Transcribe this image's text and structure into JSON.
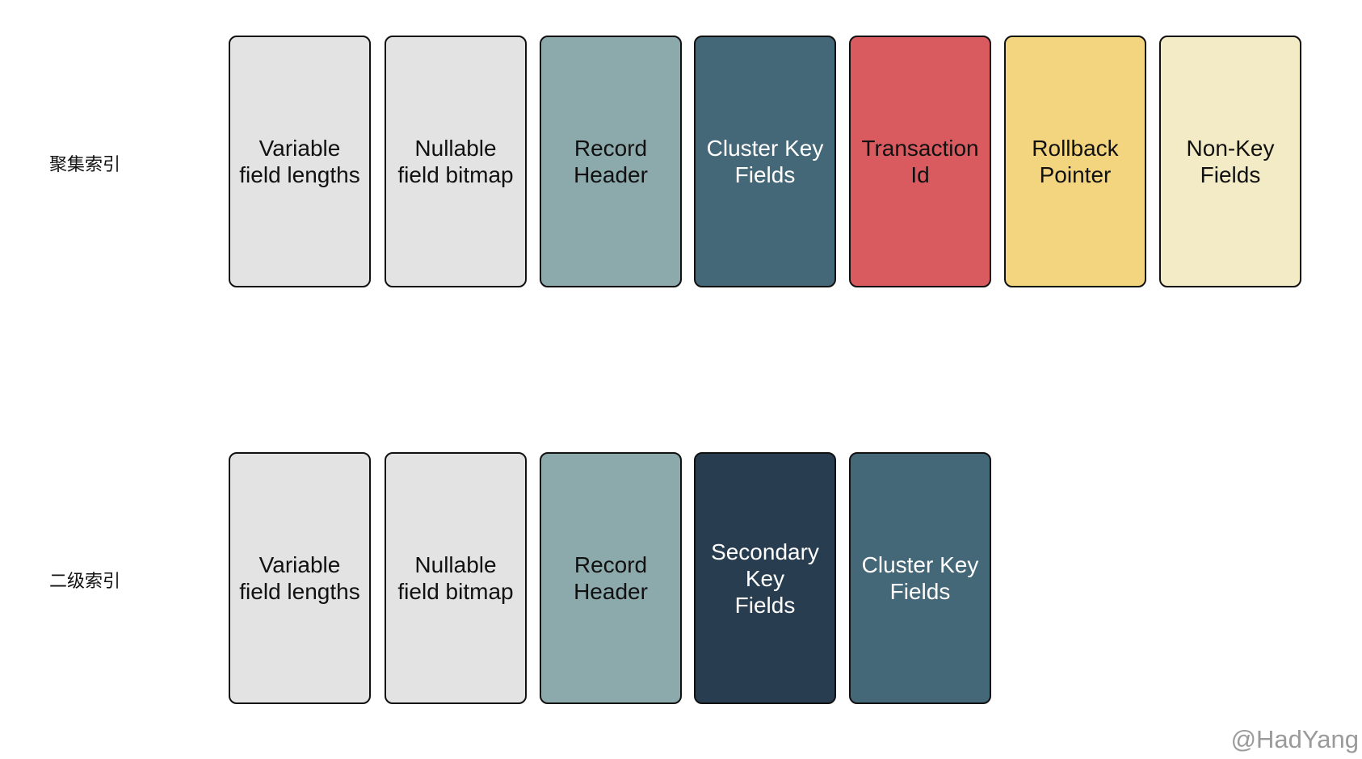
{
  "rows": [
    {
      "label": "聚集索引",
      "cells": [
        {
          "text": "Variable\nfield lengths",
          "bg": "#e3e3e3",
          "fg": "#111111"
        },
        {
          "text": "Nullable\nfield bitmap",
          "bg": "#e3e3e3",
          "fg": "#111111"
        },
        {
          "text": "Record\nHeader",
          "bg": "#8ca9ac",
          "fg": "#111111"
        },
        {
          "text": "Cluster Key\nFields",
          "bg": "#456878",
          "fg": "#ffffff"
        },
        {
          "text": "Transaction\nId",
          "bg": "#d95b60",
          "fg": "#111111"
        },
        {
          "text": "Rollback\nPointer",
          "bg": "#f3d57f",
          "fg": "#111111"
        },
        {
          "text": "Non-Key\nFields",
          "bg": "#f3ebc5",
          "fg": "#111111"
        }
      ]
    },
    {
      "label": "二级索引",
      "cells": [
        {
          "text": "Variable\nfield lengths",
          "bg": "#e3e3e3",
          "fg": "#111111"
        },
        {
          "text": "Nullable\nfield bitmap",
          "bg": "#e3e3e3",
          "fg": "#111111"
        },
        {
          "text": "Record\nHeader",
          "bg": "#8ca9ac",
          "fg": "#111111"
        },
        {
          "text": "Secondary\nKey\nFields",
          "bg": "#283e50",
          "fg": "#ffffff"
        },
        {
          "text": "Cluster Key\nFields",
          "bg": "#456878",
          "fg": "#ffffff"
        }
      ]
    }
  ],
  "watermark": "@HadYang"
}
